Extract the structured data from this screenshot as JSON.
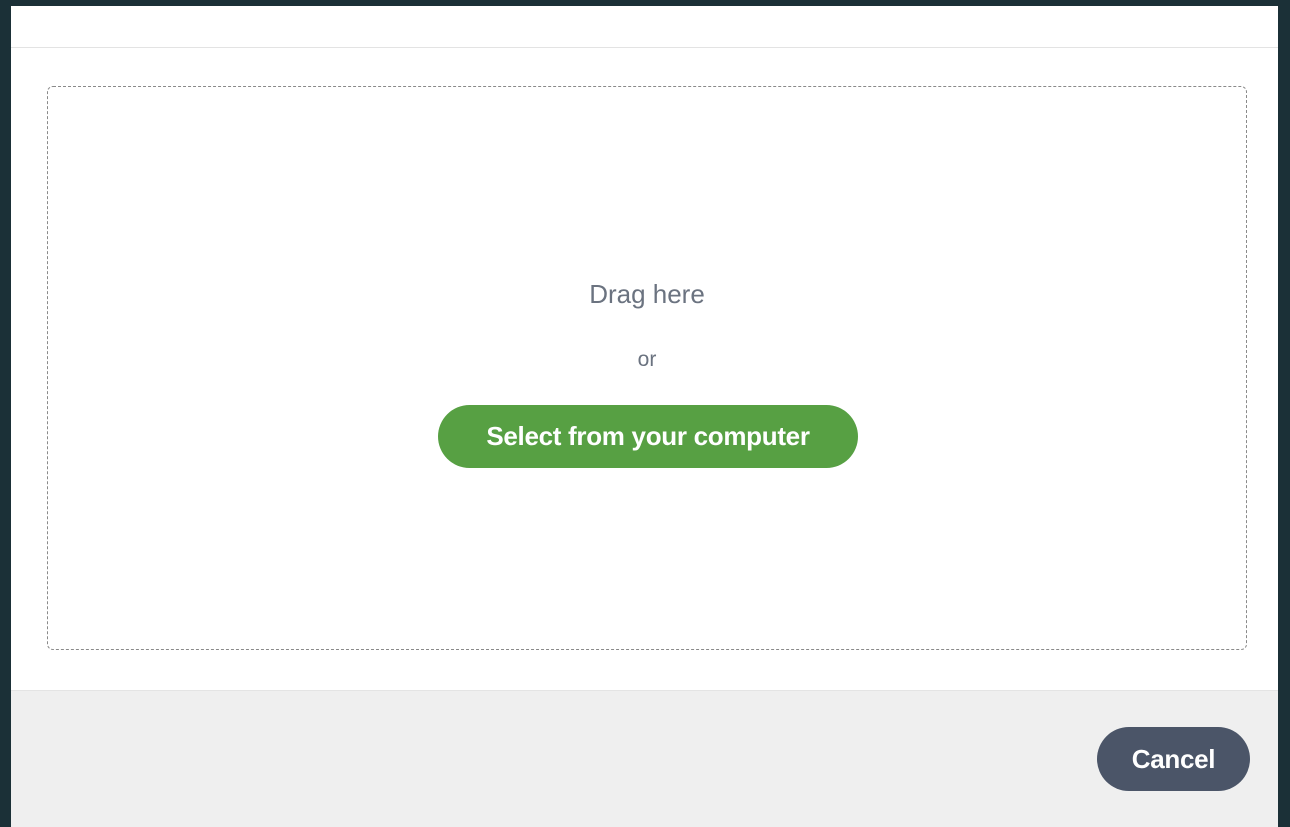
{
  "dropzone": {
    "drag_text": "Drag here",
    "or_text": "or",
    "select_label": "Select from your computer"
  },
  "footer": {
    "cancel_label": "Cancel"
  },
  "colors": {
    "backdrop": "#1b3037",
    "select_button": "#57a043",
    "cancel_button": "#4b5568",
    "footer_bg": "#efefef",
    "muted_text": "#6b7380"
  }
}
